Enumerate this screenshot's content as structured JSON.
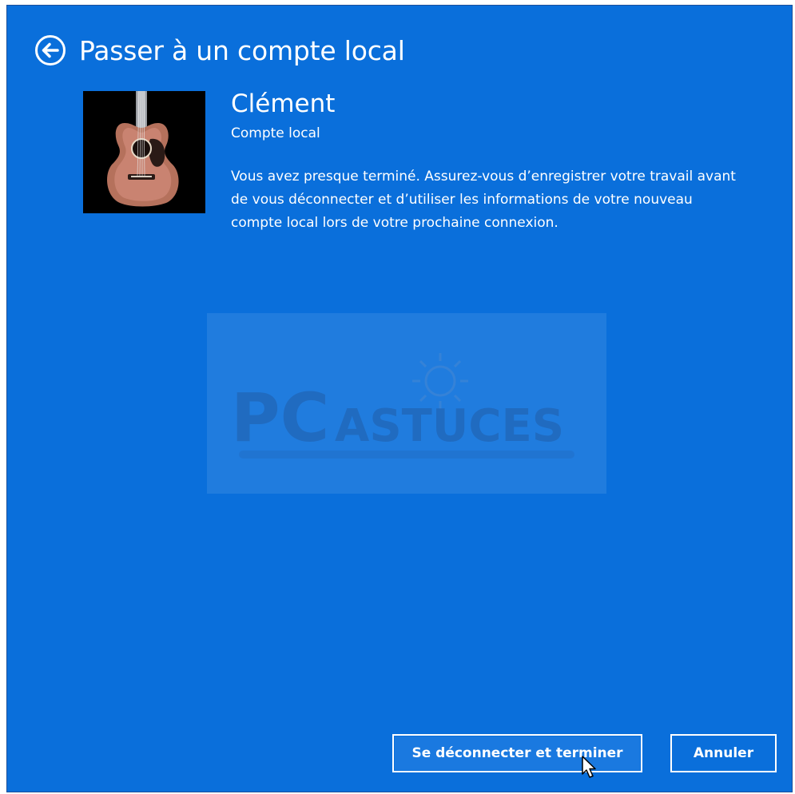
{
  "header": {
    "title": "Passer à un compte local",
    "back_icon": "back-arrow-circle-icon"
  },
  "user": {
    "name": "Clément",
    "account_type": "Compte local",
    "avatar_icon": "guitar-avatar"
  },
  "message": "Vous avez presque terminé. Assurez-vous d’enregistrer votre travail avant de vous déconnecter et d’utiliser les informations de votre nouveau compte local lors de votre prochaine connexion.",
  "watermark": {
    "text_pc": "PC",
    "text_astuces": "ASTUCES"
  },
  "buttons": {
    "primary_label": "Se déconnecter et terminer",
    "cancel_label": "Annuler"
  },
  "colors": {
    "background": "#0a6fdb",
    "text": "#ffffff"
  }
}
